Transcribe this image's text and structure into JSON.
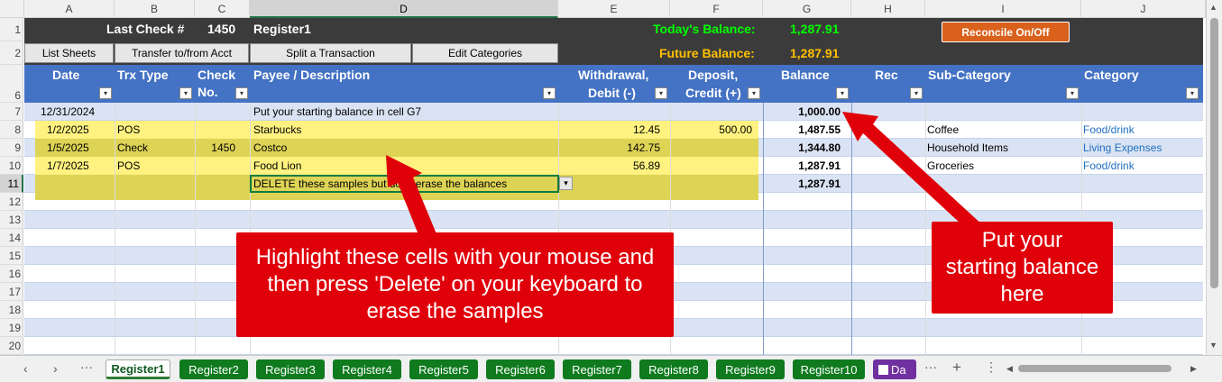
{
  "columns": [
    "A",
    "B",
    "C",
    "D",
    "E",
    "F",
    "G",
    "H",
    "I",
    "J"
  ],
  "rows": [
    "1",
    "2",
    "6",
    "7",
    "8",
    "9",
    "10",
    "11",
    "12",
    "13",
    "14",
    "15",
    "16",
    "17",
    "18",
    "19",
    "20"
  ],
  "top": {
    "last_check_label": "Last Check #",
    "last_check_value": "1450",
    "register_name": "Register1",
    "today_label": "Today's Balance:",
    "today_value": "1,287.91",
    "future_label": "Future Balance:",
    "future_value": "1,287.91",
    "reconcile_button": "Reconcile On/Off",
    "buttons": [
      "List Sheets",
      "Transfer to/from Acct",
      "Split a Transaction",
      "Edit Categories"
    ]
  },
  "headers": {
    "date": "Date",
    "trx_type": "Trx Type",
    "check_1": "Check",
    "check_2": "No.",
    "payee": "Payee / Description",
    "withdrawal_1": "Withdrawal,",
    "withdrawal_2": "Debit (-)",
    "deposit_1": "Deposit,",
    "deposit_2": "Credit (+)",
    "balance": "Balance",
    "rec": "Rec",
    "subcategory": "Sub-Category",
    "category": "Category"
  },
  "data_rows": [
    {
      "date": "12/31/2024",
      "type": "",
      "check": "",
      "payee": "Put your starting balance in cell G7",
      "withdrawal": "",
      "deposit": "",
      "balance": "1,000.00",
      "rec": "",
      "sub": "",
      "cat": ""
    },
    {
      "date": "1/2/2025",
      "type": "POS",
      "check": "",
      "payee": "Starbucks",
      "withdrawal": "12.45",
      "deposit": "500.00",
      "balance": "1,487.55",
      "rec": "",
      "sub": "Coffee",
      "cat": "Food/drink"
    },
    {
      "date": "1/5/2025",
      "type": "Check",
      "check": "1450",
      "payee": "Costco",
      "withdrawal": "142.75",
      "deposit": "",
      "balance": "1,344.80",
      "rec": "",
      "sub": "Household Items",
      "cat": "Living Expenses"
    },
    {
      "date": "1/7/2025",
      "type": "POS",
      "check": "",
      "payee": "Food Lion",
      "withdrawal": "56.89",
      "deposit": "",
      "balance": "1,287.91",
      "rec": "",
      "sub": "Groceries",
      "cat": "Food/drink"
    },
    {
      "date": "",
      "type": "",
      "check": "",
      "payee": "DELETE these samples but don't erase the balances",
      "withdrawal": "",
      "deposit": "",
      "balance": "1,287.91",
      "rec": "",
      "sub": "",
      "cat": ""
    }
  ],
  "callouts": {
    "highlight": "Highlight these cells with your mouse and then press 'Delete' on your keyboard to erase the samples",
    "starting": "Put your starting balance here"
  },
  "tabs": [
    "Register1",
    "Register2",
    "Register3",
    "Register4",
    "Register5",
    "Register6",
    "Register7",
    "Register8",
    "Register9",
    "Register10",
    "Da"
  ],
  "colors": {
    "dark_header": "#3b3b3b",
    "blue_header": "#4472c4",
    "highlight": "#fff176",
    "callout": "#e0000a",
    "tab_green": "#0f7a1e",
    "today_green": "#00ff00",
    "future_gold": "#ffc000"
  }
}
